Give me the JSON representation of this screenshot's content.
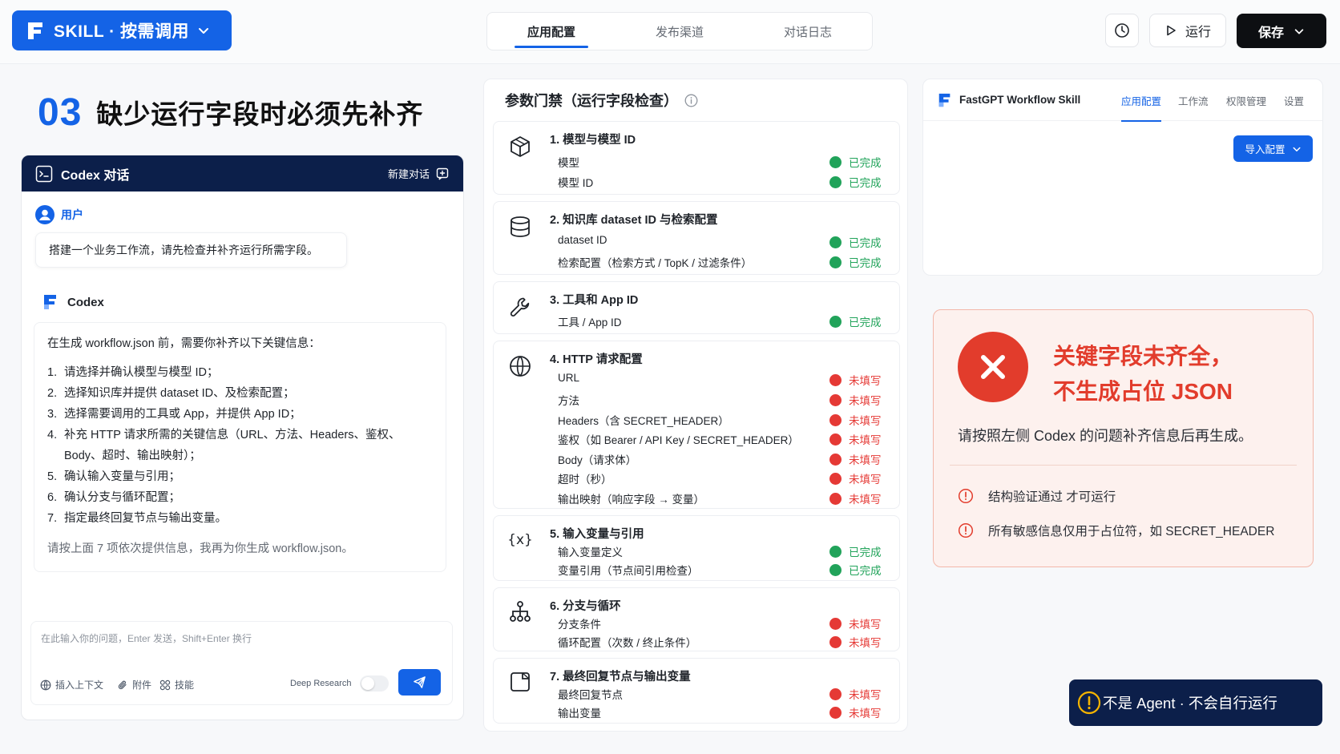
{
  "topbar": {
    "brand_label": "SKILL · 按需调用",
    "tabs": [
      "应用配置",
      "发布渠道",
      "对话日志"
    ],
    "active_tab_index": 0,
    "run_label": "运行",
    "save_label": "保存"
  },
  "step": {
    "number": "03",
    "title": "缺少运行字段时必须先补齐"
  },
  "codex_panel": {
    "title": "Codex 对话",
    "new_chat_label": "新建对话",
    "user_name": "用户",
    "user_message": "搭建一个业务工作流，请先检查并补齐运行所需字段。",
    "assistant_name": "Codex",
    "answer_intro": "在生成 workflow.json 前，需要你补齐以下关键信息：",
    "answer_items": [
      "请选择并确认模型与模型 ID；",
      "选择知识库并提供 dataset ID、及检索配置；",
      "选择需要调用的工具或 App，并提供 App ID；",
      "补充 HTTP 请求所需的关键信息（URL、方法、Headers、鉴权、Body、超时、输出映射）；",
      "确认输入变量与引用；",
      "确认分支与循环配置；",
      "指定最终回复节点与输出变量。"
    ],
    "answer_outro": "请按上面 7 项依次提供信息，我再为你生成 workflow.json。",
    "input_placeholder": "在此输入你的问题，Enter 发送，Shift+Enter 换行",
    "tools": [
      "插入上下文",
      "附件",
      "技能"
    ],
    "deep_research_label": "Deep Research",
    "deep_research_on": false
  },
  "gate": {
    "title": "参数门禁（运行字段检查）",
    "status_done": "已完成",
    "status_missing": "未填写",
    "sections": [
      {
        "title": "1. 模型与模型 ID",
        "icon": "cube-icon",
        "fields": [
          {
            "label": "模型",
            "status": "done"
          },
          {
            "label": "模型 ID",
            "status": "done"
          }
        ]
      },
      {
        "title": "2. 知识库 dataset ID 与检索配置",
        "icon": "database-icon",
        "fields": [
          {
            "label": "dataset ID",
            "status": "done"
          },
          {
            "label": "检索配置（检索方式 / TopK / 过滤条件）",
            "status": "done"
          }
        ]
      },
      {
        "title": "3. 工具和 App ID",
        "icon": "wrench-icon",
        "fields": [
          {
            "label": "工具 / App ID",
            "status": "done"
          }
        ]
      },
      {
        "title": "4. HTTP 请求配置",
        "icon": "globe-icon",
        "fields": [
          {
            "label": "URL",
            "status": "missing"
          },
          {
            "label": "方法",
            "status": "missing"
          },
          {
            "label": "Headers（含 SECRET_HEADER）",
            "status": "missing"
          },
          {
            "label": "鉴权（如 Bearer / API Key / SECRET_HEADER）",
            "status": "missing"
          },
          {
            "label": "Body（请求体）",
            "status": "missing"
          },
          {
            "label": "超时（秒）",
            "status": "missing"
          },
          {
            "label": "输出映射（响应字段 → 变量）",
            "status": "missing"
          }
        ]
      },
      {
        "title": "5. 输入变量与引用",
        "icon": "variable-icon",
        "fields": [
          {
            "label": "输入变量定义",
            "status": "done"
          },
          {
            "label": "变量引用（节点间引用检查）",
            "status": "done"
          }
        ]
      },
      {
        "title": "6. 分支与循环",
        "icon": "branch-icon",
        "fields": [
          {
            "label": "分支条件",
            "status": "missing"
          },
          {
            "label": "循环配置（次数 / 终止条件）",
            "status": "missing"
          }
        ]
      },
      {
        "title": "7. 最终回复节点与输出变量",
        "icon": "reply-node-icon",
        "fields": [
          {
            "label": "最终回复节点",
            "status": "missing"
          },
          {
            "label": "输出变量",
            "status": "missing"
          }
        ]
      }
    ]
  },
  "skill_panel": {
    "name": "FastGPT Workflow Skill",
    "tabs": [
      "应用配置",
      "工作流",
      "权限管理",
      "设置"
    ],
    "active_tab_index": 0,
    "import_label": "导入配置"
  },
  "alert": {
    "title_line1": "关键字段未齐全，",
    "title_line2": "不生成占位 JSON",
    "description": "请按照左侧 Codex 的问题补齐信息后再生成。",
    "notes": [
      "结构验证通过  才可运行",
      "所有敏感信息仅用于占位符，如 SECRET_HEADER"
    ]
  },
  "badge": {
    "label": "不是 Agent · 不会自行运行"
  },
  "colors": {
    "primary": "#1463e6",
    "navy": "#0c1f4a",
    "success": "#21a35a",
    "danger": "#e53935",
    "alert_bg": "#fdf1ee"
  }
}
